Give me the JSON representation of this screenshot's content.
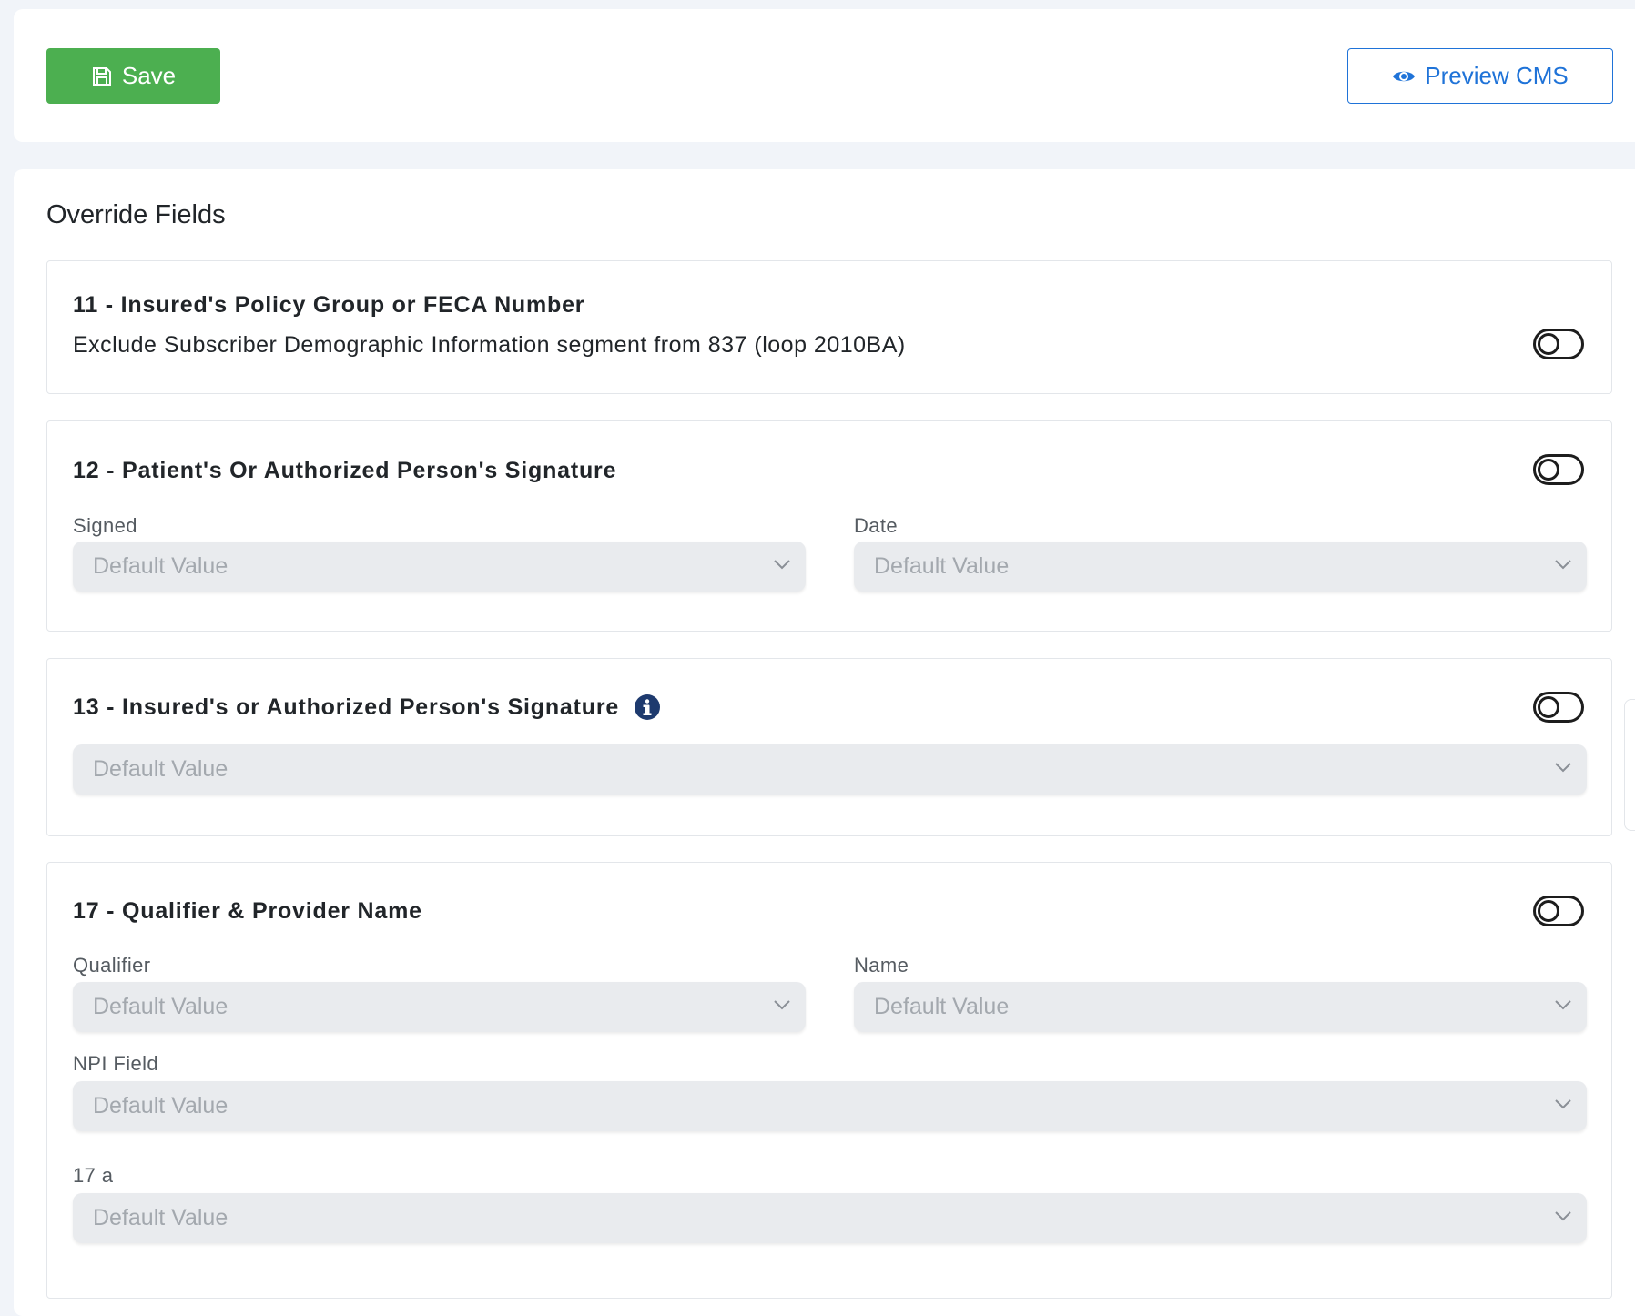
{
  "toolbar": {
    "save_label": "Save",
    "preview_label": "Preview CMS"
  },
  "section": {
    "title": "Override Fields"
  },
  "fields": [
    {
      "title": "11 - Insured's Policy Group or FECA Number",
      "description": "Exclude Subscriber Demographic Information segment from 837 (loop 2010BA)",
      "enabled": false
    },
    {
      "title": "12 - Patient's Or Authorized Person's Signature",
      "enabled": false,
      "inputs": [
        {
          "label": "Signed",
          "placeholder": "Default Value"
        },
        {
          "label": "Date",
          "placeholder": "Default Value"
        }
      ]
    },
    {
      "title": "13 - Insured's or Authorized Person's Signature",
      "enabled": false,
      "inputs": [
        {
          "label": "",
          "placeholder": "Default Value"
        }
      ]
    },
    {
      "title": "17 - Qualifier & Provider Name",
      "enabled": false,
      "inputs": [
        {
          "label": "Qualifier",
          "placeholder": "Default Value"
        },
        {
          "label": "Name",
          "placeholder": "Default Value"
        },
        {
          "label": "NPI Field",
          "placeholder": "Default Value"
        },
        {
          "label": "17 a",
          "placeholder": "Default Value"
        }
      ]
    }
  ],
  "colors": {
    "save": "#4caf50",
    "preview": "#1f73d8",
    "info_icon": "#1e3a6e"
  },
  "icons": {
    "save": "floppy-disk-icon",
    "preview": "eye-icon",
    "info": "info-icon",
    "chevron": "chevron-down-icon"
  }
}
